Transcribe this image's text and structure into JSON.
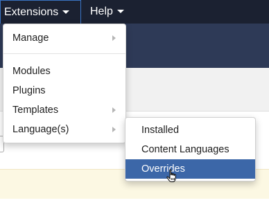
{
  "topnav": {
    "extensions_label": "Extensions",
    "help_label": "Help"
  },
  "extensions_menu": {
    "items": [
      {
        "label": "Manage",
        "has_submenu": true
      },
      {
        "label": "Modules",
        "has_submenu": false
      },
      {
        "label": "Plugins",
        "has_submenu": false
      },
      {
        "label": "Templates",
        "has_submenu": true
      },
      {
        "label": "Language(s)",
        "has_submenu": true
      }
    ]
  },
  "languages_submenu": {
    "items": [
      {
        "label": "Installed"
      },
      {
        "label": "Content Languages"
      },
      {
        "label": "Overrides"
      }
    ],
    "active": "Overrides"
  },
  "colors": {
    "topbar": "#1b2131",
    "active_item": "#3c67a8",
    "header_band": "#2e3a57",
    "notice": "#fcf8e3"
  },
  "icons": {
    "caret": "caret-down-icon",
    "submenu": "chevron-right-icon",
    "cursor": "hand-pointer-icon"
  }
}
